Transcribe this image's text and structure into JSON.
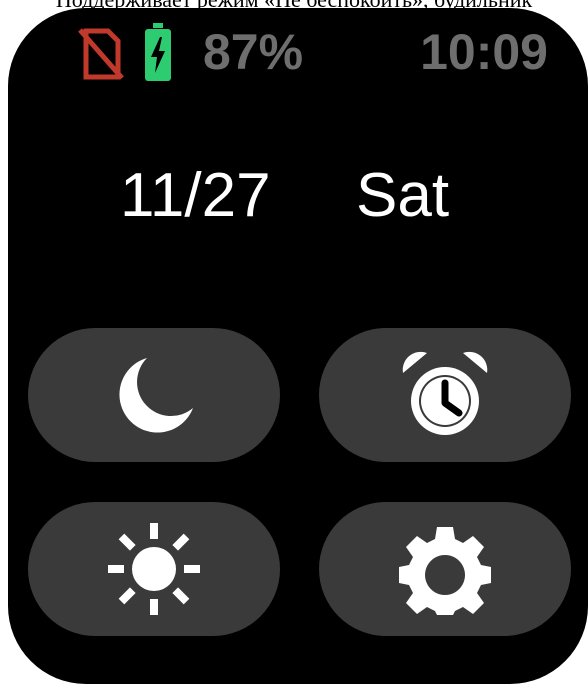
{
  "caption": "Поддерживает режим «Не беспокоить», будильник",
  "status_bar": {
    "battery_percent": "87%",
    "time": "10:09",
    "icons": [
      "no-sim-icon",
      "battery-charging-icon"
    ],
    "colors": {
      "no_sim": "#c0392b",
      "battery": "#2ecc71",
      "text": "#6e6e6e"
    }
  },
  "date": {
    "date": "11/27",
    "weekday": "Sat"
  },
  "quick_tiles": [
    {
      "name": "do-not-disturb",
      "icon": "moon-icon"
    },
    {
      "name": "alarm",
      "icon": "alarm-clock-icon"
    },
    {
      "name": "brightness",
      "icon": "sun-icon"
    },
    {
      "name": "settings",
      "icon": "gear-icon"
    }
  ],
  "colors": {
    "screen_bg": "#000000",
    "tile_bg": "#3a3a3a",
    "primary_text": "#ffffff"
  }
}
